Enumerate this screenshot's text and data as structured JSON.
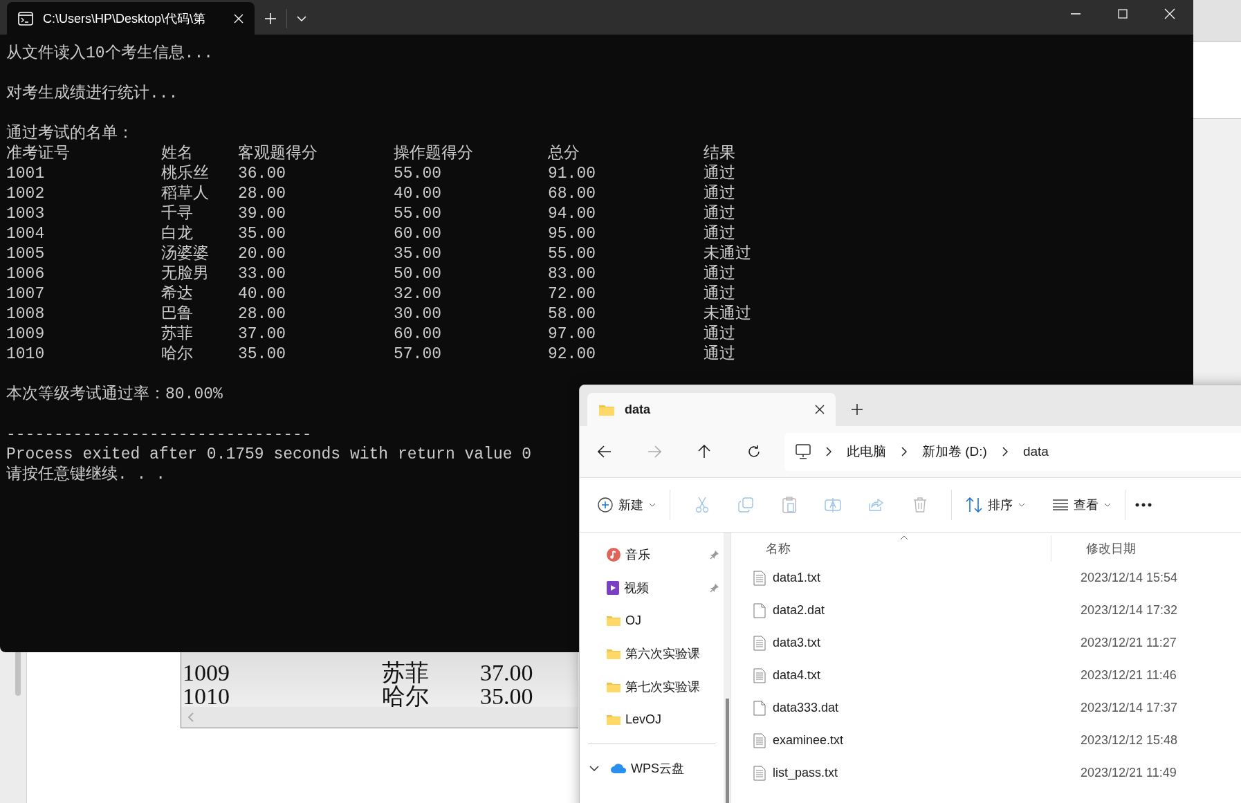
{
  "terminal": {
    "tab_title": "C:\\Users\\HP\\Desktop\\代码\\第",
    "intro_lines": [
      "从文件读入10个考生信息...",
      "对考生成绩进行统计..."
    ],
    "list_title": "通过考试的名单：",
    "columns": [
      "准考证号",
      "姓名",
      "客观题得分",
      "操作题得分",
      "总分",
      "结果"
    ],
    "rows": [
      [
        "1001",
        "桃乐丝",
        "36.00",
        "55.00",
        "91.00",
        "通过"
      ],
      [
        "1002",
        "稻草人",
        "28.00",
        "40.00",
        "68.00",
        "通过"
      ],
      [
        "1003",
        "千寻",
        "39.00",
        "55.00",
        "94.00",
        "通过"
      ],
      [
        "1004",
        "白龙",
        "35.00",
        "60.00",
        "95.00",
        "通过"
      ],
      [
        "1005",
        "汤婆婆",
        "20.00",
        "35.00",
        "55.00",
        "未通过"
      ],
      [
        "1006",
        "无脸男",
        "33.00",
        "50.00",
        "83.00",
        "通过"
      ],
      [
        "1007",
        "希达",
        "40.00",
        "32.00",
        "72.00",
        "通过"
      ],
      [
        "1008",
        "巴鲁",
        "28.00",
        "30.00",
        "58.00",
        "未通过"
      ],
      [
        "1009",
        "苏菲",
        "37.00",
        "60.00",
        "97.00",
        "通过"
      ],
      [
        "1010",
        "哈尔",
        "35.00",
        "57.00",
        "92.00",
        "通过"
      ]
    ],
    "pass_rate": "本次等级考试通过率：80.00%",
    "separator": "--------------------------------",
    "exit_message": "Process exited after 0.1759 seconds with return value 0",
    "prompt": "请按任意键继续. . ."
  },
  "background_window": {
    "rows": [
      [
        "1009",
        "苏菲",
        "37.00"
      ],
      [
        "1010",
        "哈尔",
        "35.00"
      ]
    ]
  },
  "explorer": {
    "tab_title": "data",
    "breadcrumb": [
      "此电脑",
      "新加卷 (D:)",
      "data"
    ],
    "toolbar": {
      "new": "新建",
      "sort": "排序",
      "view": "查看"
    },
    "sidebar": [
      {
        "label": "音乐",
        "kind": "music",
        "pinned": true
      },
      {
        "label": "视频",
        "kind": "video",
        "pinned": true
      },
      {
        "label": "OJ",
        "kind": "folder",
        "pinned": false
      },
      {
        "label": "第六次实验课",
        "kind": "folder",
        "pinned": false
      },
      {
        "label": "第七次实验课",
        "kind": "folder",
        "pinned": false
      },
      {
        "label": "LevOJ",
        "kind": "folder",
        "pinned": false
      },
      {
        "label": "WPS云盘",
        "kind": "cloud",
        "pinned": false
      }
    ],
    "columns": [
      "名称",
      "修改日期"
    ],
    "files": [
      {
        "name": "data1.txt",
        "date": "2023/12/14 15:54",
        "kind": "text"
      },
      {
        "name": "data2.dat",
        "date": "2023/12/14 17:32",
        "kind": "blank"
      },
      {
        "name": "data3.txt",
        "date": "2023/12/21 11:27",
        "kind": "text"
      },
      {
        "name": "data4.txt",
        "date": "2023/12/21 11:46",
        "kind": "text"
      },
      {
        "name": "data333.dat",
        "date": "2023/12/14 17:37",
        "kind": "blank"
      },
      {
        "name": "examinee.txt",
        "date": "2023/12/12 15:48",
        "kind": "text"
      },
      {
        "name": "list_pass.txt",
        "date": "2023/12/21 11:49",
        "kind": "text"
      }
    ]
  }
}
